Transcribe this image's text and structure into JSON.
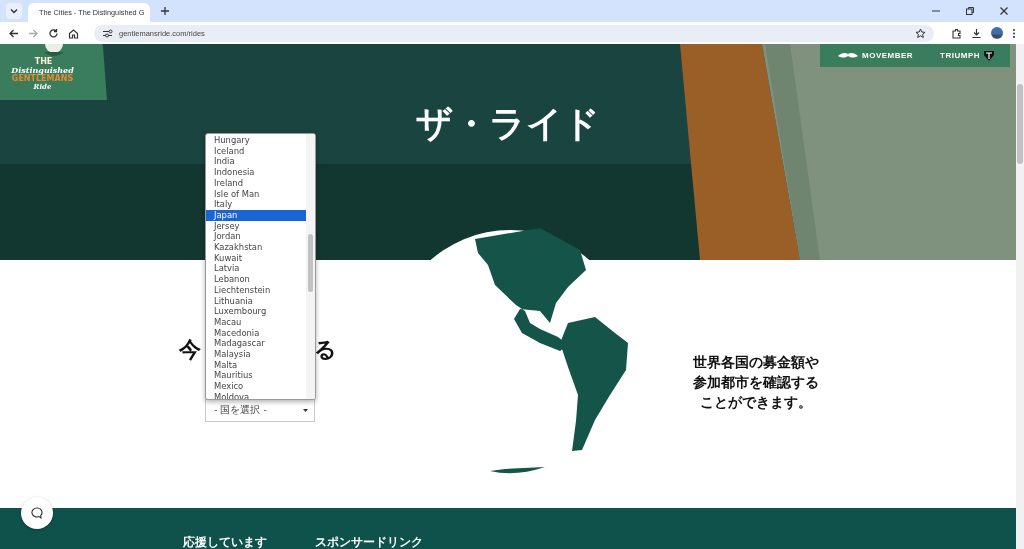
{
  "browser": {
    "tab_title": "The Cities - The Distinguished G",
    "url": "gentlemansride.com/rides"
  },
  "logo": {
    "small": "THE",
    "line_1": "Distinguished",
    "line_2": "GENTLEMANS",
    "line_3": "Ride"
  },
  "sponsors": [
    "MOVEMBER",
    "TRIUMPH"
  ],
  "hero": {
    "title": "ザ・ライド"
  },
  "heading_fragments": [
    "今",
    "る"
  ],
  "country_select": {
    "value": "- 国を選択 -",
    "expanded": true,
    "options": [
      {
        "label": "Hungary",
        "selected": false
      },
      {
        "label": "Iceland",
        "selected": false
      },
      {
        "label": "India",
        "selected": false
      },
      {
        "label": "Indonesia",
        "selected": false
      },
      {
        "label": "Ireland",
        "selected": false
      },
      {
        "label": "Isle of Man",
        "selected": false
      },
      {
        "label": "Italy",
        "selected": false
      },
      {
        "label": "Japan",
        "selected": true
      },
      {
        "label": "Jersey",
        "selected": false
      },
      {
        "label": "Jordan",
        "selected": false
      },
      {
        "label": "Kazakhstan",
        "selected": false
      },
      {
        "label": "Kuwait",
        "selected": false
      },
      {
        "label": "Latvia",
        "selected": false
      },
      {
        "label": "Lebanon",
        "selected": false
      },
      {
        "label": "Liechtenstein",
        "selected": false
      },
      {
        "label": "Lithuania",
        "selected": false
      },
      {
        "label": "Luxembourg",
        "selected": false
      },
      {
        "label": "Macau",
        "selected": false
      },
      {
        "label": "Macedonia",
        "selected": false
      },
      {
        "label": "Madagascar",
        "selected": false
      },
      {
        "label": "Malaysia",
        "selected": false
      },
      {
        "label": "Malta",
        "selected": false
      },
      {
        "label": "Mauritius",
        "selected": false
      },
      {
        "label": "Mexico",
        "selected": false
      },
      {
        "label": "Moldova",
        "selected": false
      }
    ]
  },
  "info_lines": [
    "世界各国の募金額や",
    "参加都市を確認する",
    "ことができます。"
  ],
  "footer": {
    "headings": [
      "応援しています",
      "スポンサードリンク"
    ]
  }
}
